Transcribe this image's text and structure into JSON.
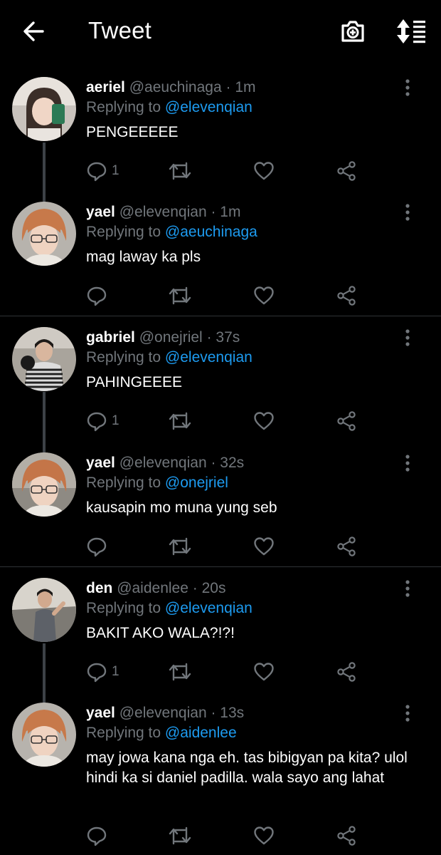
{
  "header": {
    "title": "Tweet"
  },
  "icons": {
    "back": "arrow-left-icon",
    "camera": "camera-plus-icon",
    "sort": "sort-icon"
  },
  "tweets": [
    {
      "name": "aeriel",
      "handle": "@aeuchinaga",
      "time": "· 1m",
      "reply_prefix": "Replying to",
      "reply_to": "@elevenqian",
      "text": "PENGEEEEE",
      "reply_count": "1"
    },
    {
      "name": "yael",
      "handle": "@elevenqian",
      "time": "· 1m",
      "reply_prefix": "Replying to",
      "reply_to": "@aeuchinaga",
      "text": "mag laway ka pls",
      "reply_count": ""
    },
    {
      "name": "gabriel",
      "handle": "@onejriel",
      "time": "· 37s",
      "reply_prefix": "Replying to",
      "reply_to": "@elevenqian",
      "text": "PAHINGEEEE",
      "reply_count": "1"
    },
    {
      "name": "yael",
      "handle": "@elevenqian",
      "time": "· 32s",
      "reply_prefix": "Replying to",
      "reply_to": "@onejriel",
      "text": "kausapin mo muna yung seb",
      "reply_count": ""
    },
    {
      "name": "den",
      "handle": "@aidenlee",
      "time": "· 20s",
      "reply_prefix": "Replying to",
      "reply_to": "@elevenqian",
      "text": "BAKIT AKO WALA?!?!",
      "reply_count": "1"
    },
    {
      "name": "yael",
      "handle": "@elevenqian",
      "time": "· 13s",
      "reply_prefix": "Replying to",
      "reply_to": "@aidenlee",
      "text": "may jowa kana nga eh. tas bibigyan pa kita? ulol hindi ka si daniel padilla. wala sayo ang lahat",
      "reply_count": ""
    }
  ],
  "colors": {
    "background": "#000000",
    "mention": "#1d9bf0",
    "muted": "#71767b",
    "thread_line": "#3d4247"
  }
}
